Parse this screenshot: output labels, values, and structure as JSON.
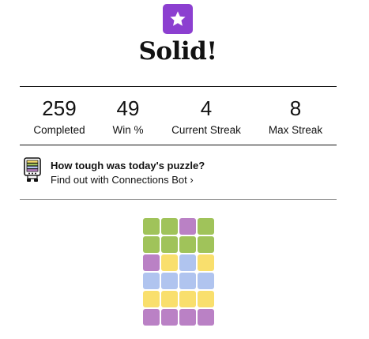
{
  "result": {
    "headline": "Solid!",
    "badge_icon": "star-icon",
    "badge_color": "#8c3fd0"
  },
  "stats": [
    {
      "value": "259",
      "label": "Completed"
    },
    {
      "value": "49",
      "label": "Win %"
    },
    {
      "value": "4",
      "label": "Current Streak"
    },
    {
      "value": "8",
      "label": "Max Streak"
    }
  ],
  "promo": {
    "icon": "connections-bot-icon",
    "title": "How tough was today's puzzle?",
    "link_text": "Find out with Connections Bot ›"
  },
  "colors": {
    "green": "#a0c35a",
    "purple": "#ba81c5",
    "yellow": "#f9df6d",
    "blue": "#b0c4ef"
  },
  "guesses": [
    [
      "green",
      "green",
      "purple",
      "green"
    ],
    [
      "green",
      "green",
      "green",
      "green"
    ],
    [
      "purple",
      "yellow",
      "blue",
      "yellow"
    ],
    [
      "blue",
      "blue",
      "blue",
      "blue"
    ],
    [
      "yellow",
      "yellow",
      "yellow",
      "yellow"
    ],
    [
      "purple",
      "purple",
      "purple",
      "purple"
    ]
  ]
}
